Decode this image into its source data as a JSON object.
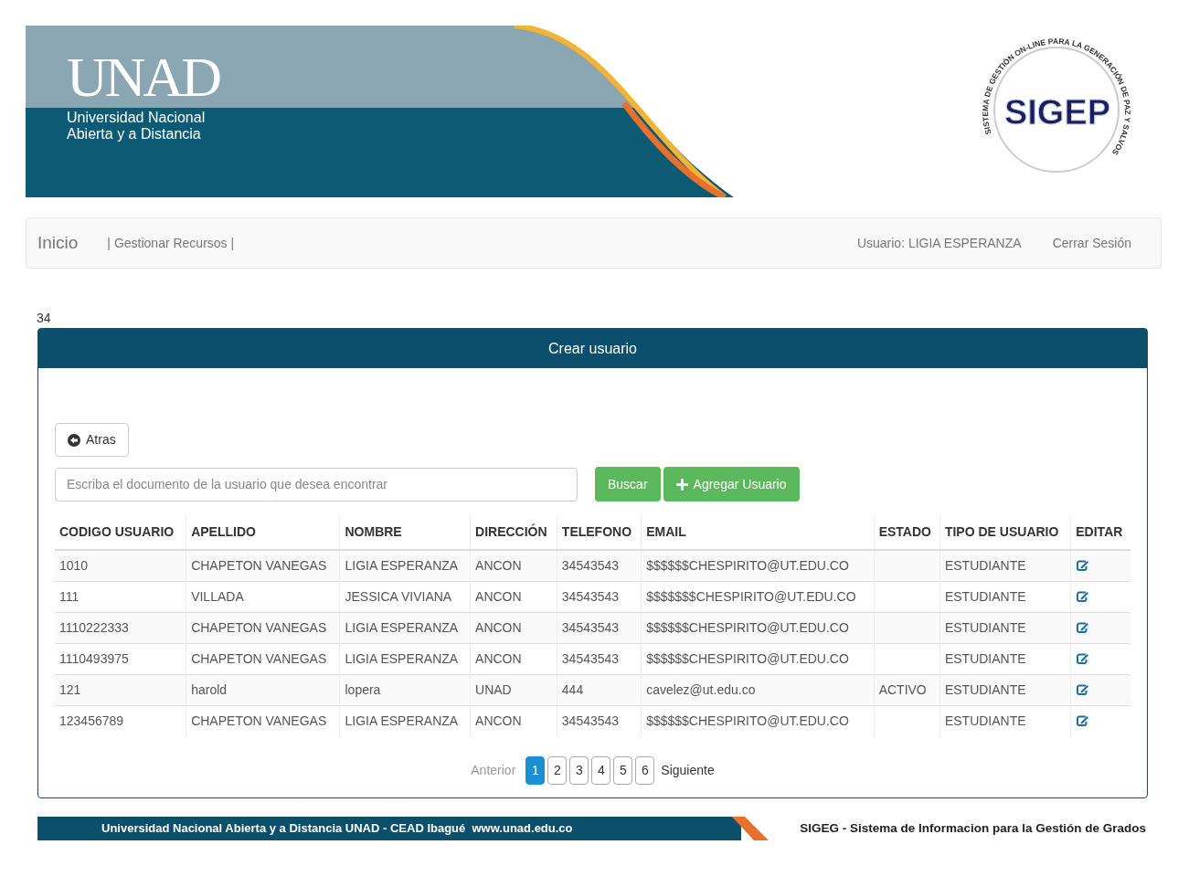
{
  "header": {
    "logo": {
      "wordmark": "UNAD",
      "line_1": "Universidad Nacional",
      "line_2": "Abierta y a Distancia"
    },
    "seal": {
      "ring_text": "SISTEMA DE GESTIÓN ON-LINE PARA LA GENERACIÓN DE PAZ Y SALVOS",
      "name": "SIGEP"
    }
  },
  "nav": {
    "home": "Inicio",
    "menu": "| Gestionar Recursos |",
    "user": "Usuario: LIGIA ESPERANZA",
    "logout": "Cerrar Sesión"
  },
  "count": "34",
  "panel": {
    "title": "Crear usuario",
    "back_button": "Atras",
    "search": {
      "placeholder": "Escriba el documento de la usuario que desea encontrar"
    },
    "search_button": "Buscar",
    "add_button": "Agregar Usuario",
    "table": {
      "columns": [
        "CODIGO USUARIO",
        "APELLIDO",
        "NOMBRE",
        "DIRECCIÓN",
        "TELEFONO",
        "EMAIL",
        "ESTADO",
        "TIPO DE USUARIO",
        "EDITAR"
      ],
      "rows": [
        {
          "cells": [
            "1010",
            "CHAPETON VANEGAS",
            "LIGIA ESPERANZA",
            "ANCON",
            "34543543",
            "$$$$$$CHESPIRITO@UT.EDU.CO",
            "",
            "ESTUDIANTE"
          ]
        },
        {
          "cells": [
            "111",
            "VILLADA",
            "JESSICA VIVIANA",
            "ANCON",
            "34543543",
            "$$$$$$$CHESPIRITO@UT.EDU.CO",
            "",
            "ESTUDIANTE"
          ]
        },
        {
          "cells": [
            "1110222333",
            "CHAPETON VANEGAS",
            "LIGIA ESPERANZA",
            "ANCON",
            "34543543",
            "$$$$$$CHESPIRITO@UT.EDU.CO",
            "",
            "ESTUDIANTE"
          ]
        },
        {
          "cells": [
            "1110493975",
            "CHAPETON VANEGAS",
            "LIGIA ESPERANZA",
            "ANCON",
            "34543543",
            "$$$$$$CHESPIRITO@UT.EDU.CO",
            "",
            "ESTUDIANTE"
          ]
        },
        {
          "cells": [
            "121",
            "harold",
            "lopera",
            "UNAD",
            "444",
            "cavelez@ut.edu.co",
            "ACTIVO",
            "ESTUDIANTE"
          ]
        },
        {
          "cells": [
            "123456789",
            "CHAPETON VANEGAS",
            "LIGIA ESPERANZA",
            "ANCON",
            "34543543",
            "$$$$$$CHESPIRITO@UT.EDU.CO",
            "",
            "ESTUDIANTE"
          ]
        }
      ]
    },
    "pagination": {
      "previous": {
        "label": "Anterior",
        "disabled": true
      },
      "pages": [
        {
          "label": "1",
          "selected": true
        },
        {
          "label": "2",
          "selected": false
        },
        {
          "label": "3",
          "selected": false
        },
        {
          "label": "4",
          "selected": false
        },
        {
          "label": "5",
          "selected": false
        },
        {
          "label": "6",
          "selected": false
        }
      ],
      "next": {
        "label": "Siguiente",
        "disabled": false
      }
    }
  },
  "footer": {
    "left": "Universidad Nacional Abierta y a Distancia UNAD - CEAD Ibagué  www.unad.edu.co",
    "right": "SIGEG - Sistema de Informacion para la Gestión de Grados"
  }
}
